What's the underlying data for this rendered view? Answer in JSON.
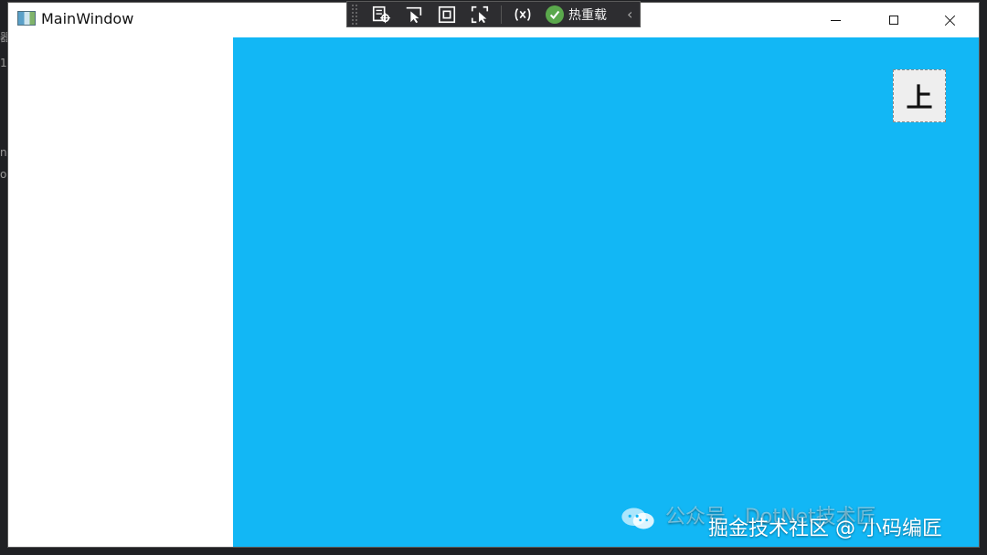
{
  "window": {
    "title": "MainWindow",
    "controls": {
      "minimize": "minimize",
      "maximize": "maximize",
      "close": "close"
    }
  },
  "toolbar": {
    "hot_reload_label": "热重载",
    "icons": [
      "select-element-icon",
      "pointer-select-icon",
      "layout-adorner-icon",
      "track-focus-icon",
      "binding-failure-icon",
      "hot-reload-check-icon"
    ]
  },
  "content": {
    "button_label": "上",
    "accent_color": "#12b7f5"
  },
  "watermark": {
    "faint_text": "公众号 · DotNet技术匠",
    "main_text": "掘金技术社区 @ 小码编匠"
  }
}
